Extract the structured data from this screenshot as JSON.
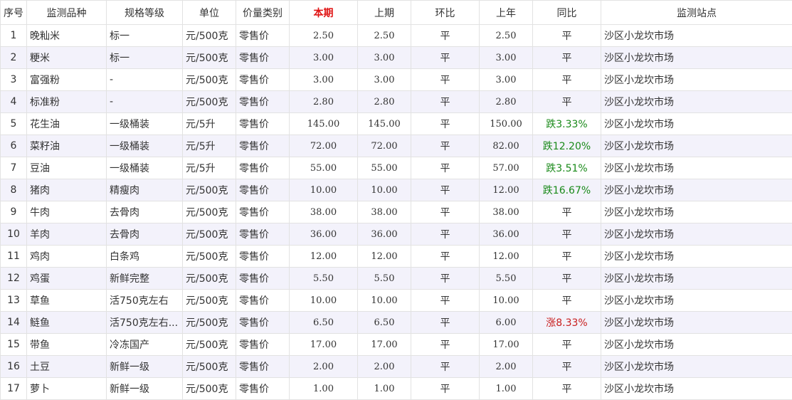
{
  "headers": [
    "序号",
    "监测品种",
    "规格等级",
    "单位",
    "价量类别",
    "本期",
    "上期",
    "环比",
    "上年",
    "同比",
    "监测站点"
  ],
  "highlight_header_index": 5,
  "colors": {
    "highlight": "#e01515",
    "down": "#1a8a1a",
    "up": "#c81e1e",
    "stripe": "#f3f2fb",
    "border": "#e2e2e2"
  },
  "rows": [
    {
      "no": "1",
      "item": "晚籼米",
      "spec": "标一",
      "unit": "元/500克",
      "category": "零售价",
      "current": "2.50",
      "previous": "2.50",
      "mom": "平",
      "last_year": "2.50",
      "yoy": "平",
      "yoy_trend": "flat",
      "station": "沙区小龙坎市场"
    },
    {
      "no": "2",
      "item": "粳米",
      "spec": "标一",
      "unit": "元/500克",
      "category": "零售价",
      "current": "3.00",
      "previous": "3.00",
      "mom": "平",
      "last_year": "3.00",
      "yoy": "平",
      "yoy_trend": "flat",
      "station": "沙区小龙坎市场"
    },
    {
      "no": "3",
      "item": "富强粉",
      "spec": "-",
      "unit": "元/500克",
      "category": "零售价",
      "current": "3.00",
      "previous": "3.00",
      "mom": "平",
      "last_year": "3.00",
      "yoy": "平",
      "yoy_trend": "flat",
      "station": "沙区小龙坎市场"
    },
    {
      "no": "4",
      "item": "标准粉",
      "spec": "-",
      "unit": "元/500克",
      "category": "零售价",
      "current": "2.80",
      "previous": "2.80",
      "mom": "平",
      "last_year": "2.80",
      "yoy": "平",
      "yoy_trend": "flat",
      "station": "沙区小龙坎市场"
    },
    {
      "no": "5",
      "item": "花生油",
      "spec": "一级桶装",
      "unit": "元/5升",
      "category": "零售价",
      "current": "145.00",
      "previous": "145.00",
      "mom": "平",
      "last_year": "150.00",
      "yoy": "跌3.33%",
      "yoy_trend": "down",
      "station": "沙区小龙坎市场"
    },
    {
      "no": "6",
      "item": "菜籽油",
      "spec": "一级桶装",
      "unit": "元/5升",
      "category": "零售价",
      "current": "72.00",
      "previous": "72.00",
      "mom": "平",
      "last_year": "82.00",
      "yoy": "跌12.20%",
      "yoy_trend": "down",
      "station": "沙区小龙坎市场"
    },
    {
      "no": "7",
      "item": "豆油",
      "spec": "一级桶装",
      "unit": "元/5升",
      "category": "零售价",
      "current": "55.00",
      "previous": "55.00",
      "mom": "平",
      "last_year": "57.00",
      "yoy": "跌3.51%",
      "yoy_trend": "down",
      "station": "沙区小龙坎市场"
    },
    {
      "no": "8",
      "item": "猪肉",
      "spec": "精瘦肉",
      "unit": "元/500克",
      "category": "零售价",
      "current": "10.00",
      "previous": "10.00",
      "mom": "平",
      "last_year": "12.00",
      "yoy": "跌16.67%",
      "yoy_trend": "down",
      "station": "沙区小龙坎市场"
    },
    {
      "no": "9",
      "item": "牛肉",
      "spec": "去骨肉",
      "unit": "元/500克",
      "category": "零售价",
      "current": "38.00",
      "previous": "38.00",
      "mom": "平",
      "last_year": "38.00",
      "yoy": "平",
      "yoy_trend": "flat",
      "station": "沙区小龙坎市场"
    },
    {
      "no": "10",
      "item": "羊肉",
      "spec": "去骨肉",
      "unit": "元/500克",
      "category": "零售价",
      "current": "36.00",
      "previous": "36.00",
      "mom": "平",
      "last_year": "36.00",
      "yoy": "平",
      "yoy_trend": "flat",
      "station": "沙区小龙坎市场"
    },
    {
      "no": "11",
      "item": "鸡肉",
      "spec": "白条鸡",
      "unit": "元/500克",
      "category": "零售价",
      "current": "12.00",
      "previous": "12.00",
      "mom": "平",
      "last_year": "12.00",
      "yoy": "平",
      "yoy_trend": "flat",
      "station": "沙区小龙坎市场"
    },
    {
      "no": "12",
      "item": "鸡蛋",
      "spec": "新鲜完整",
      "unit": "元/500克",
      "category": "零售价",
      "current": "5.50",
      "previous": "5.50",
      "mom": "平",
      "last_year": "5.50",
      "yoy": "平",
      "yoy_trend": "flat",
      "station": "沙区小龙坎市场"
    },
    {
      "no": "13",
      "item": "草鱼",
      "spec": "活750克左右",
      "unit": "元/500克",
      "category": "零售价",
      "current": "10.00",
      "previous": "10.00",
      "mom": "平",
      "last_year": "10.00",
      "yoy": "平",
      "yoy_trend": "flat",
      "station": "沙区小龙坎市场"
    },
    {
      "no": "14",
      "item": "鲢鱼",
      "spec": "活750克左右...",
      "unit": "元/500克",
      "category": "零售价",
      "current": "6.50",
      "previous": "6.50",
      "mom": "平",
      "last_year": "6.00",
      "yoy": "涨8.33%",
      "yoy_trend": "up",
      "station": "沙区小龙坎市场"
    },
    {
      "no": "15",
      "item": "带鱼",
      "spec": "冷冻国产",
      "unit": "元/500克",
      "category": "零售价",
      "current": "17.00",
      "previous": "17.00",
      "mom": "平",
      "last_year": "17.00",
      "yoy": "平",
      "yoy_trend": "flat",
      "station": "沙区小龙坎市场"
    },
    {
      "no": "16",
      "item": "土豆",
      "spec": "新鲜一级",
      "unit": "元/500克",
      "category": "零售价",
      "current": "2.00",
      "previous": "2.00",
      "mom": "平",
      "last_year": "2.00",
      "yoy": "平",
      "yoy_trend": "flat",
      "station": "沙区小龙坎市场"
    },
    {
      "no": "17",
      "item": "萝卜",
      "spec": "新鲜一级",
      "unit": "元/500克",
      "category": "零售价",
      "current": "1.00",
      "previous": "1.00",
      "mom": "平",
      "last_year": "1.00",
      "yoy": "平",
      "yoy_trend": "flat",
      "station": "沙区小龙坎市场"
    }
  ]
}
